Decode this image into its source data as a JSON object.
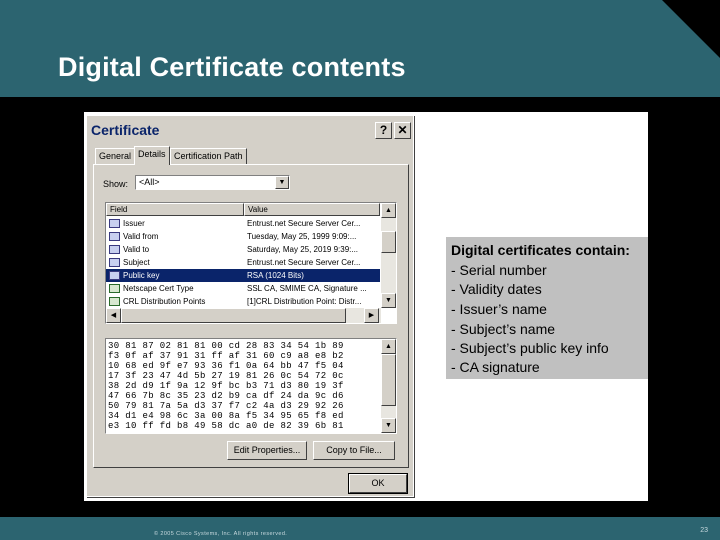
{
  "slide": {
    "title": "Digital Certificate contents",
    "footer": {
      "copyright": "© 2005 Cisco Systems, Inc. All rights reserved.",
      "page": "23"
    }
  },
  "dialog": {
    "title": "Certificate",
    "help_label": "?",
    "close_label": "✕",
    "tabs": [
      {
        "label": "General"
      },
      {
        "label": "Details"
      },
      {
        "label": "Certification Path"
      }
    ],
    "active_tab": "Details",
    "show_label": "Show:",
    "show_value": "<All>",
    "columns": [
      "Field",
      "Value"
    ],
    "rows": [
      {
        "field": "Issuer",
        "value": "Entrust.net Secure Server Cer..."
      },
      {
        "field": "Valid from",
        "value": "Tuesday, May 25, 1999 9:09:..."
      },
      {
        "field": "Valid to",
        "value": "Saturday, May 25, 2019 9:39:..."
      },
      {
        "field": "Subject",
        "value": "Entrust.net Secure Server Cer..."
      },
      {
        "field": "Public key",
        "value": "RSA (1024 Bits)"
      },
      {
        "field": "Netscape Cert Type",
        "value": "SSL CA, SMIME CA, Signature ..."
      },
      {
        "field": "CRL Distribution Points",
        "value": "[1]CRL Distribution Point: Distr..."
      }
    ],
    "selected_row": 4,
    "hex_lines": [
      "30 81 87 02 81 81 00 cd 28 83 34 54 1b 89",
      "f3 0f af 37 91 31 ff af 31 60 c9 a8 e8 b2",
      "10 68 ed 9f e7 93 36 f1 0a 64 bb 47 f5 04",
      "17 3f 23 47 4d 5b 27 19 81 26 0c 54 72 0c",
      "38 2d d9 1f 9a 12 9f bc b3 71 d3 80 19 3f",
      "47 66 7b 8c 35 23 d2 b9 ca df 24 da 9c d6",
      "50 79 81 7a 5a d3 37 f7 c2 4a d3 29 92 26",
      "34 d1 e4 98 6c 3a 00 8a f5 34 95 65 f8 ed",
      "e3 10 ff fd b8 49 58 dc a0 de 82 39 6b 81"
    ],
    "edit_properties_label": "Edit Properties...",
    "copy_to_file_label": "Copy to File...",
    "ok_label": "OK"
  },
  "callout": {
    "heading": "Digital certificates contain:",
    "items": [
      "- Serial number",
      "- Validity dates",
      "- Issuer’s name",
      "- Subject’s name",
      "- Subject’s public key info",
      "- CA signature"
    ]
  },
  "colors": {
    "header_bg": "#2c6470",
    "titlebar_text": "#0a246a",
    "selection_bg": "#0a246a",
    "callout_bg": "#c0c0c0"
  }
}
